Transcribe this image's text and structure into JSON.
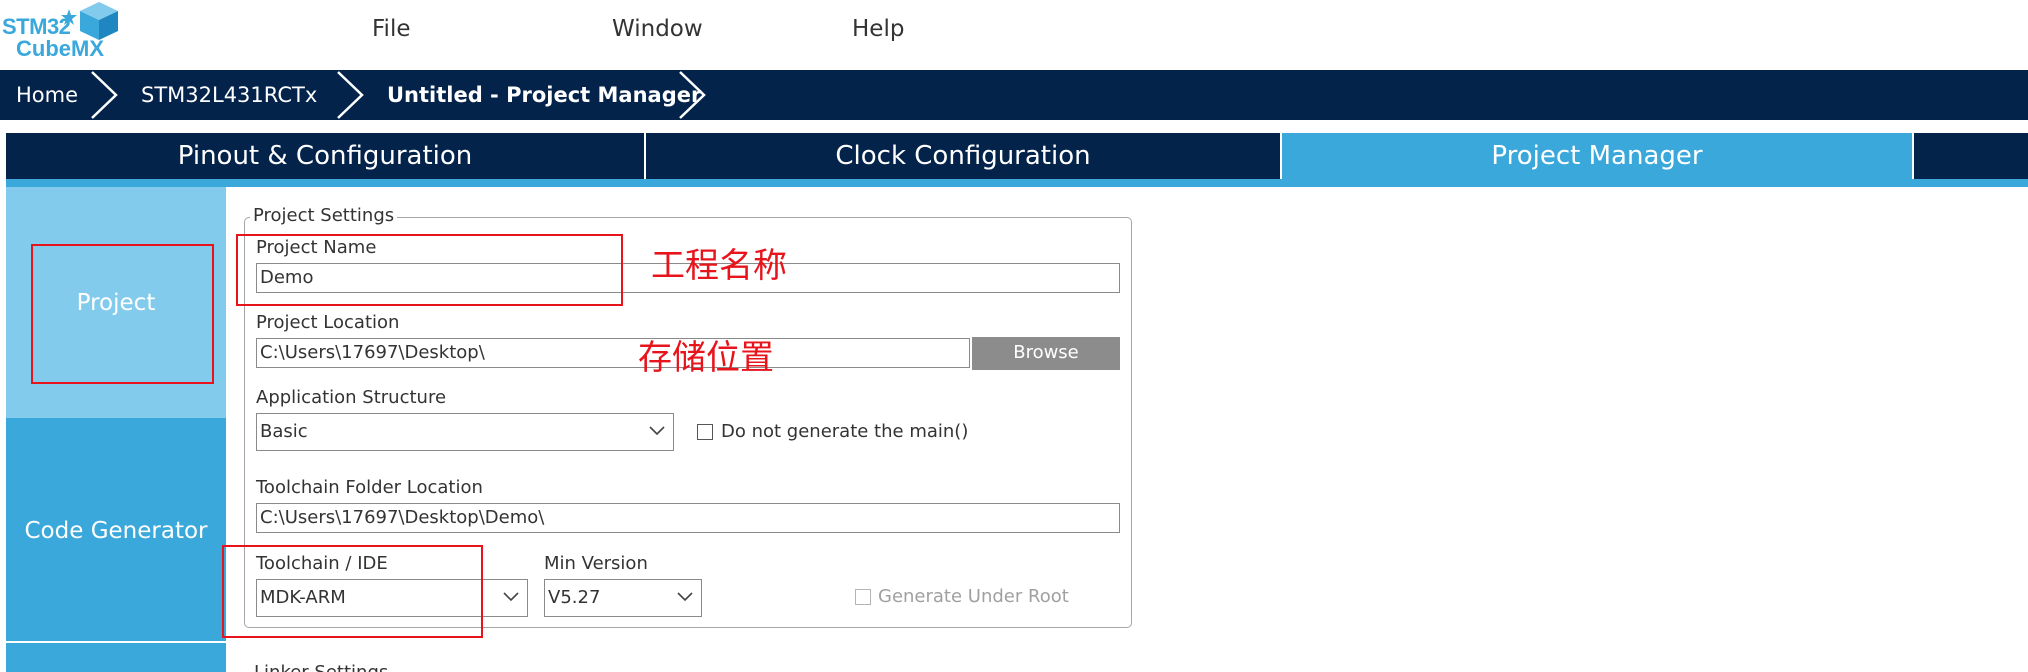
{
  "logo": {
    "line1": "STM32",
    "line2": "CubeMX"
  },
  "menu": {
    "file": "File",
    "window": "Window",
    "help": "Help"
  },
  "breadcrumb": {
    "home": "Home",
    "device": "STM32L431RCTx",
    "current": "Untitled - Project Manager"
  },
  "tabs": {
    "pinout": "Pinout & Configuration",
    "clock": "Clock Configuration",
    "project_manager": "Project Manager"
  },
  "sidebar": {
    "project": "Project",
    "code_generator": "Code Generator"
  },
  "project_settings": {
    "title": "Project Settings",
    "project_name": {
      "label": "Project Name",
      "value": "Demo"
    },
    "project_location": {
      "label": "Project Location",
      "value": "C:\\Users\\17697\\Desktop\\",
      "browse": "Browse"
    },
    "application_structure": {
      "label": "Application Structure",
      "value": "Basic",
      "no_main_label": "Do not generate the main()"
    },
    "toolchain_folder": {
      "label": "Toolchain Folder Location",
      "value": "C:\\Users\\17697\\Desktop\\Demo\\"
    },
    "toolchain_ide": {
      "label": "Toolchain / IDE",
      "value": "MDK-ARM"
    },
    "min_version": {
      "label": "Min Version",
      "value": "V5.27"
    },
    "generate_under_root": {
      "label": "Generate Under Root"
    }
  },
  "linker_settings": {
    "title": "Linker Settings"
  },
  "annotations": {
    "project_name": "工程名称",
    "storage_location": "存储位置"
  },
  "colors": {
    "dark_navy": "#03234b",
    "accent_blue": "#3aa8db",
    "light_blue": "#83cbec",
    "annotation_red": "#e8141c",
    "button_gray": "#8c8c8c"
  }
}
